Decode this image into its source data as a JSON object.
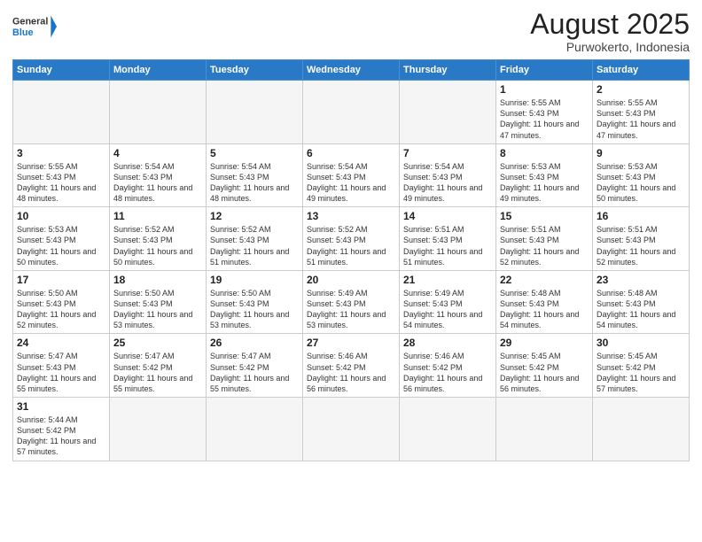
{
  "logo": {
    "text_general": "General",
    "text_blue": "Blue"
  },
  "header": {
    "month_year": "August 2025",
    "location": "Purwokerto, Indonesia"
  },
  "days_of_week": [
    "Sunday",
    "Monday",
    "Tuesday",
    "Wednesday",
    "Thursday",
    "Friday",
    "Saturday"
  ],
  "weeks": [
    [
      {
        "day": "",
        "info": ""
      },
      {
        "day": "",
        "info": ""
      },
      {
        "day": "",
        "info": ""
      },
      {
        "day": "",
        "info": ""
      },
      {
        "day": "",
        "info": ""
      },
      {
        "day": "1",
        "info": "Sunrise: 5:55 AM\nSunset: 5:43 PM\nDaylight: 11 hours\nand 47 minutes."
      },
      {
        "day": "2",
        "info": "Sunrise: 5:55 AM\nSunset: 5:43 PM\nDaylight: 11 hours\nand 47 minutes."
      }
    ],
    [
      {
        "day": "3",
        "info": "Sunrise: 5:55 AM\nSunset: 5:43 PM\nDaylight: 11 hours\nand 48 minutes."
      },
      {
        "day": "4",
        "info": "Sunrise: 5:54 AM\nSunset: 5:43 PM\nDaylight: 11 hours\nand 48 minutes."
      },
      {
        "day": "5",
        "info": "Sunrise: 5:54 AM\nSunset: 5:43 PM\nDaylight: 11 hours\nand 48 minutes."
      },
      {
        "day": "6",
        "info": "Sunrise: 5:54 AM\nSunset: 5:43 PM\nDaylight: 11 hours\nand 49 minutes."
      },
      {
        "day": "7",
        "info": "Sunrise: 5:54 AM\nSunset: 5:43 PM\nDaylight: 11 hours\nand 49 minutes."
      },
      {
        "day": "8",
        "info": "Sunrise: 5:53 AM\nSunset: 5:43 PM\nDaylight: 11 hours\nand 49 minutes."
      },
      {
        "day": "9",
        "info": "Sunrise: 5:53 AM\nSunset: 5:43 PM\nDaylight: 11 hours\nand 50 minutes."
      }
    ],
    [
      {
        "day": "10",
        "info": "Sunrise: 5:53 AM\nSunset: 5:43 PM\nDaylight: 11 hours\nand 50 minutes."
      },
      {
        "day": "11",
        "info": "Sunrise: 5:52 AM\nSunset: 5:43 PM\nDaylight: 11 hours\nand 50 minutes."
      },
      {
        "day": "12",
        "info": "Sunrise: 5:52 AM\nSunset: 5:43 PM\nDaylight: 11 hours\nand 51 minutes."
      },
      {
        "day": "13",
        "info": "Sunrise: 5:52 AM\nSunset: 5:43 PM\nDaylight: 11 hours\nand 51 minutes."
      },
      {
        "day": "14",
        "info": "Sunrise: 5:51 AM\nSunset: 5:43 PM\nDaylight: 11 hours\nand 51 minutes."
      },
      {
        "day": "15",
        "info": "Sunrise: 5:51 AM\nSunset: 5:43 PM\nDaylight: 11 hours\nand 52 minutes."
      },
      {
        "day": "16",
        "info": "Sunrise: 5:51 AM\nSunset: 5:43 PM\nDaylight: 11 hours\nand 52 minutes."
      }
    ],
    [
      {
        "day": "17",
        "info": "Sunrise: 5:50 AM\nSunset: 5:43 PM\nDaylight: 11 hours\nand 52 minutes."
      },
      {
        "day": "18",
        "info": "Sunrise: 5:50 AM\nSunset: 5:43 PM\nDaylight: 11 hours\nand 53 minutes."
      },
      {
        "day": "19",
        "info": "Sunrise: 5:50 AM\nSunset: 5:43 PM\nDaylight: 11 hours\nand 53 minutes."
      },
      {
        "day": "20",
        "info": "Sunrise: 5:49 AM\nSunset: 5:43 PM\nDaylight: 11 hours\nand 53 minutes."
      },
      {
        "day": "21",
        "info": "Sunrise: 5:49 AM\nSunset: 5:43 PM\nDaylight: 11 hours\nand 54 minutes."
      },
      {
        "day": "22",
        "info": "Sunrise: 5:48 AM\nSunset: 5:43 PM\nDaylight: 11 hours\nand 54 minutes."
      },
      {
        "day": "23",
        "info": "Sunrise: 5:48 AM\nSunset: 5:43 PM\nDaylight: 11 hours\nand 54 minutes."
      }
    ],
    [
      {
        "day": "24",
        "info": "Sunrise: 5:47 AM\nSunset: 5:43 PM\nDaylight: 11 hours\nand 55 minutes."
      },
      {
        "day": "25",
        "info": "Sunrise: 5:47 AM\nSunset: 5:42 PM\nDaylight: 11 hours\nand 55 minutes."
      },
      {
        "day": "26",
        "info": "Sunrise: 5:47 AM\nSunset: 5:42 PM\nDaylight: 11 hours\nand 55 minutes."
      },
      {
        "day": "27",
        "info": "Sunrise: 5:46 AM\nSunset: 5:42 PM\nDaylight: 11 hours\nand 56 minutes."
      },
      {
        "day": "28",
        "info": "Sunrise: 5:46 AM\nSunset: 5:42 PM\nDaylight: 11 hours\nand 56 minutes."
      },
      {
        "day": "29",
        "info": "Sunrise: 5:45 AM\nSunset: 5:42 PM\nDaylight: 11 hours\nand 56 minutes."
      },
      {
        "day": "30",
        "info": "Sunrise: 5:45 AM\nSunset: 5:42 PM\nDaylight: 11 hours\nand 57 minutes."
      }
    ],
    [
      {
        "day": "31",
        "info": "Sunrise: 5:44 AM\nSunset: 5:42 PM\nDaylight: 11 hours\nand 57 minutes."
      },
      {
        "day": "",
        "info": ""
      },
      {
        "day": "",
        "info": ""
      },
      {
        "day": "",
        "info": ""
      },
      {
        "day": "",
        "info": ""
      },
      {
        "day": "",
        "info": ""
      },
      {
        "day": "",
        "info": ""
      }
    ]
  ]
}
